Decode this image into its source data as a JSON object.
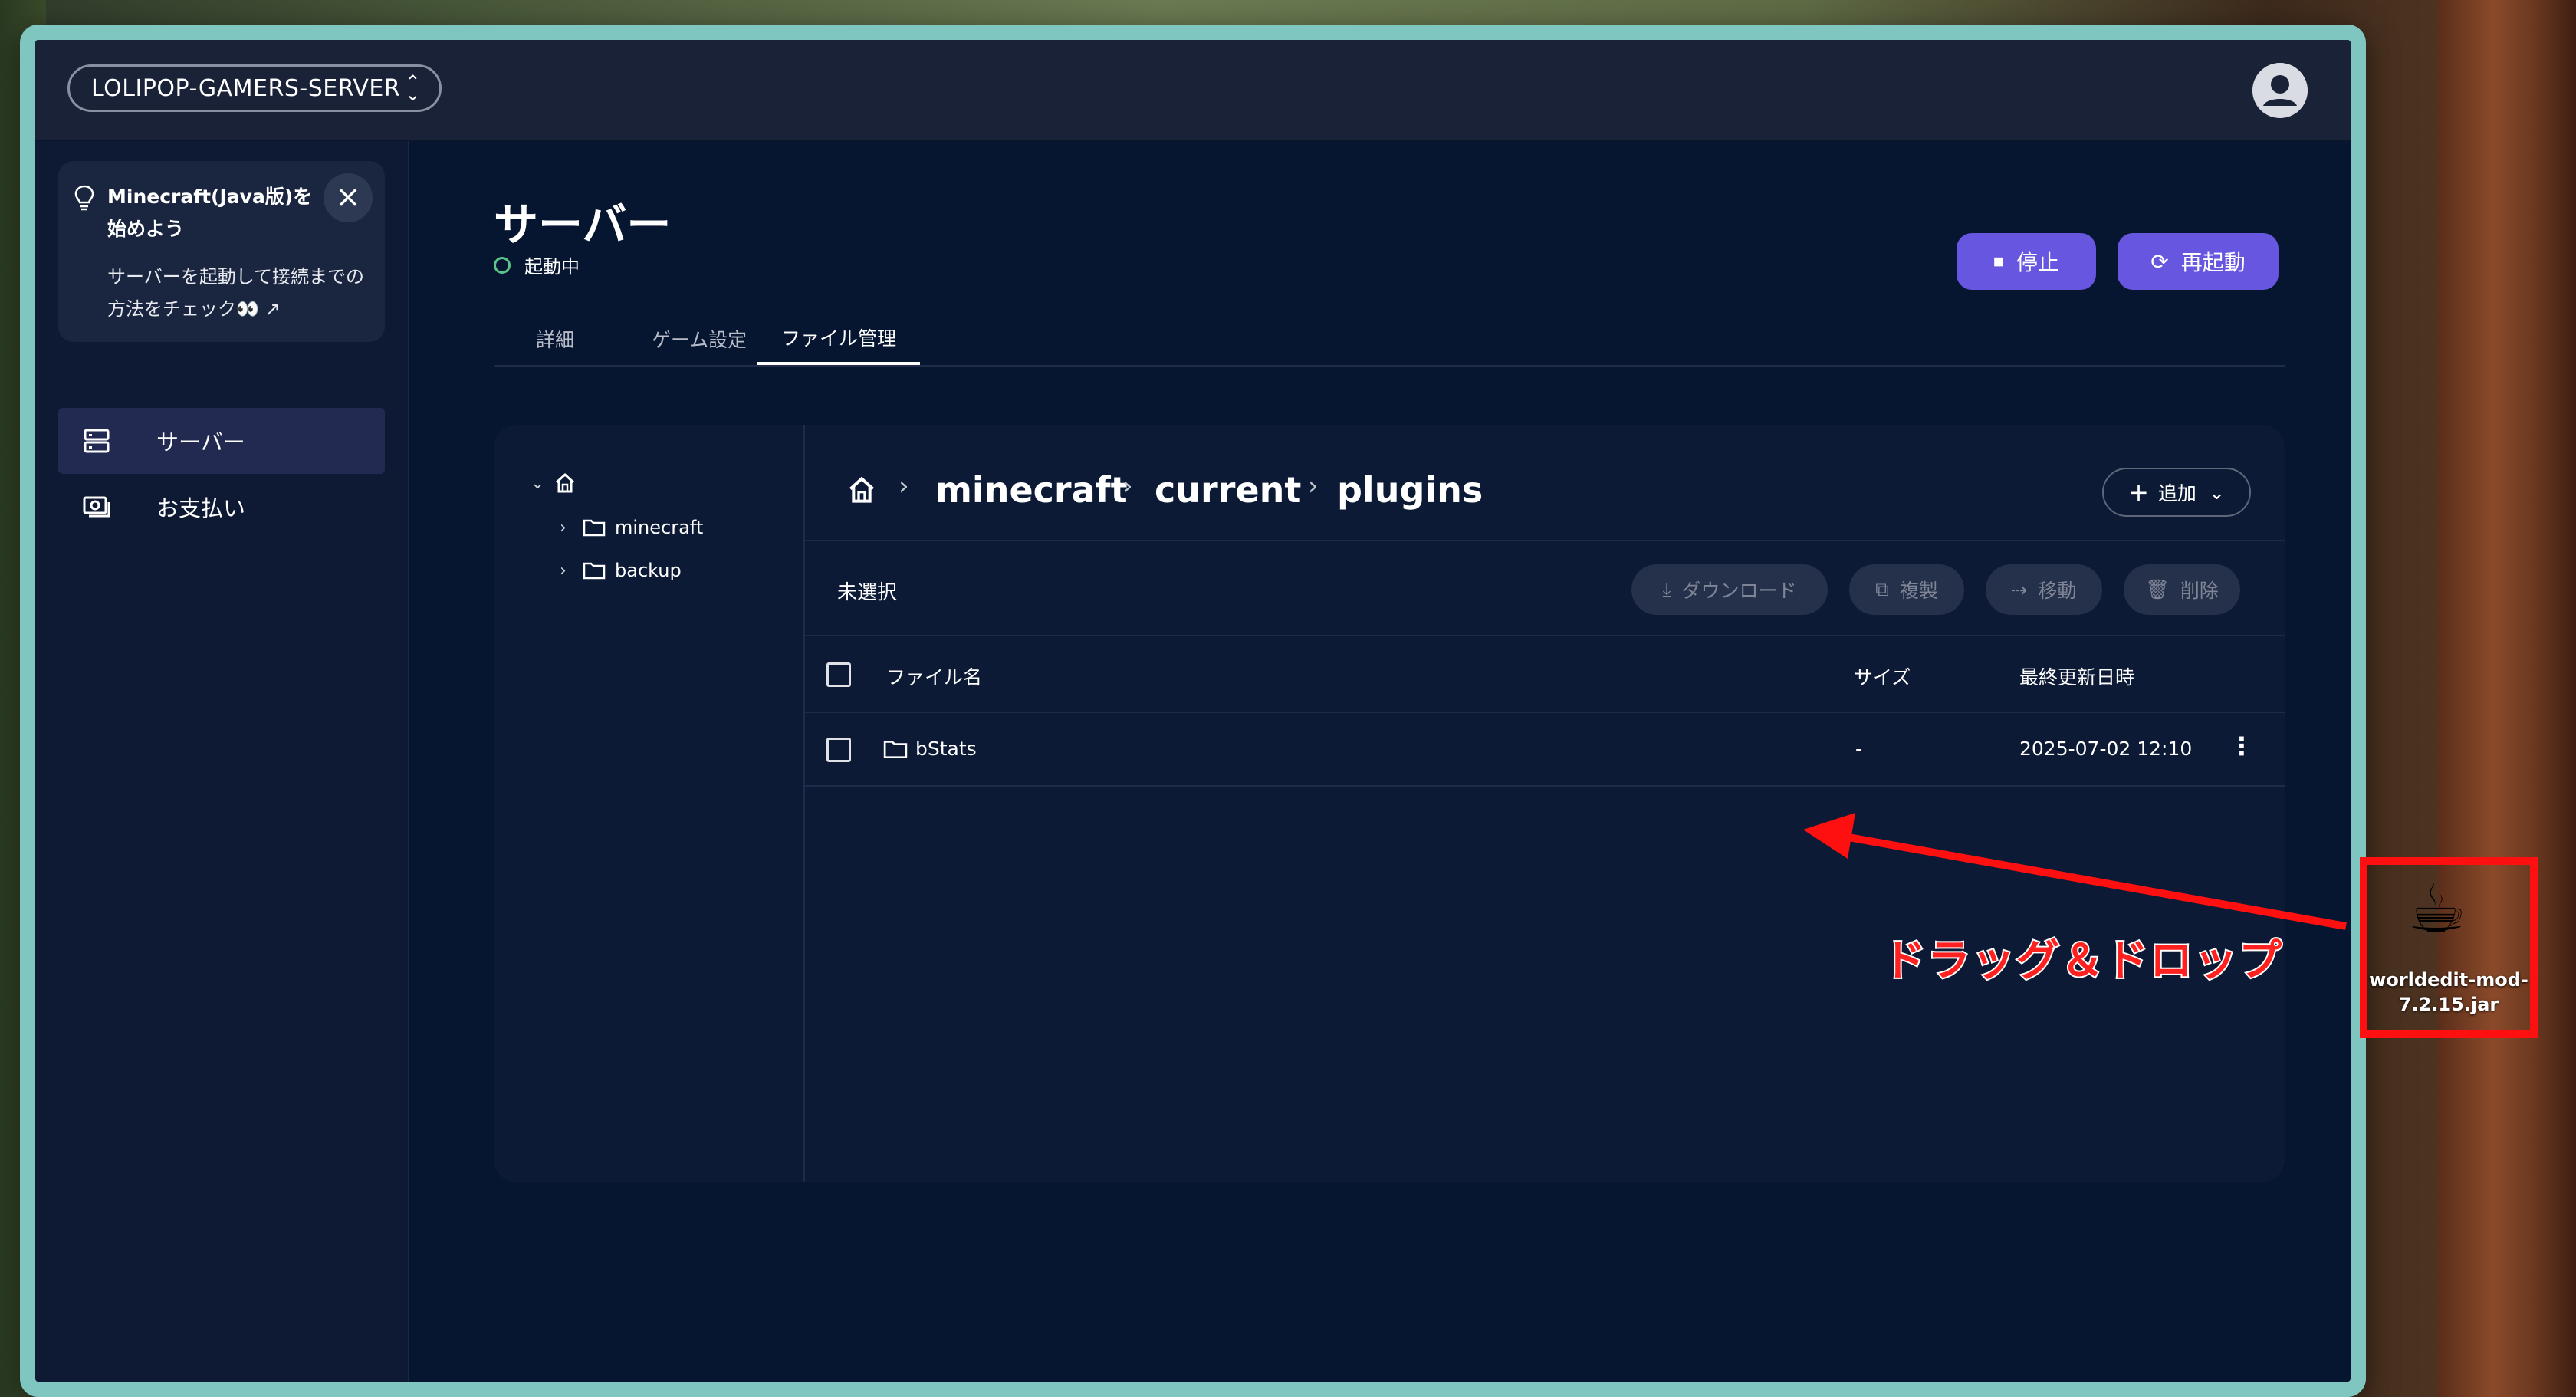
{
  "header": {
    "server_name": "LOLIPOP-GAMERS-SERVER"
  },
  "sidebar": {
    "tip": {
      "title": "Minecraft(Java版)を始めよう",
      "body": "サーバーを起動して接続までの方法をチェック👀"
    },
    "items": [
      {
        "label": "サーバー",
        "active": true,
        "icon": "server-icon"
      },
      {
        "label": "お支払い",
        "active": false,
        "icon": "payment-icon"
      }
    ]
  },
  "page": {
    "title": "サーバー",
    "status": "起動中",
    "status_color": "#5bc48a",
    "stop_label": "停止",
    "restart_label": "再起動"
  },
  "tabs": [
    {
      "label": "詳細",
      "active": false
    },
    {
      "label": "ゲーム設定",
      "active": false
    },
    {
      "label": "ファイル管理",
      "active": true
    }
  ],
  "tree": {
    "folders": [
      "minecraft",
      "backup"
    ]
  },
  "breadcrumb": [
    "minecraft",
    "current",
    "plugins"
  ],
  "add_label": "追加",
  "toolbar": {
    "selection": "未選択",
    "download": "ダウンロード",
    "copy": "複製",
    "move": "移動",
    "delete": "削除"
  },
  "table": {
    "columns": {
      "name": "ファイル名",
      "size": "サイズ",
      "modified": "最終更新日時"
    },
    "rows": [
      {
        "name": "bStats",
        "size": "-",
        "modified": "2025-07-02 12:10",
        "type": "folder"
      }
    ]
  },
  "annotation": {
    "text": "ドラッグ＆ドロップ",
    "color": "#ff1010"
  },
  "desktop_file": {
    "name": "worldedit-mod-7.2.15.jar",
    "icon": "java-cup-icon"
  }
}
